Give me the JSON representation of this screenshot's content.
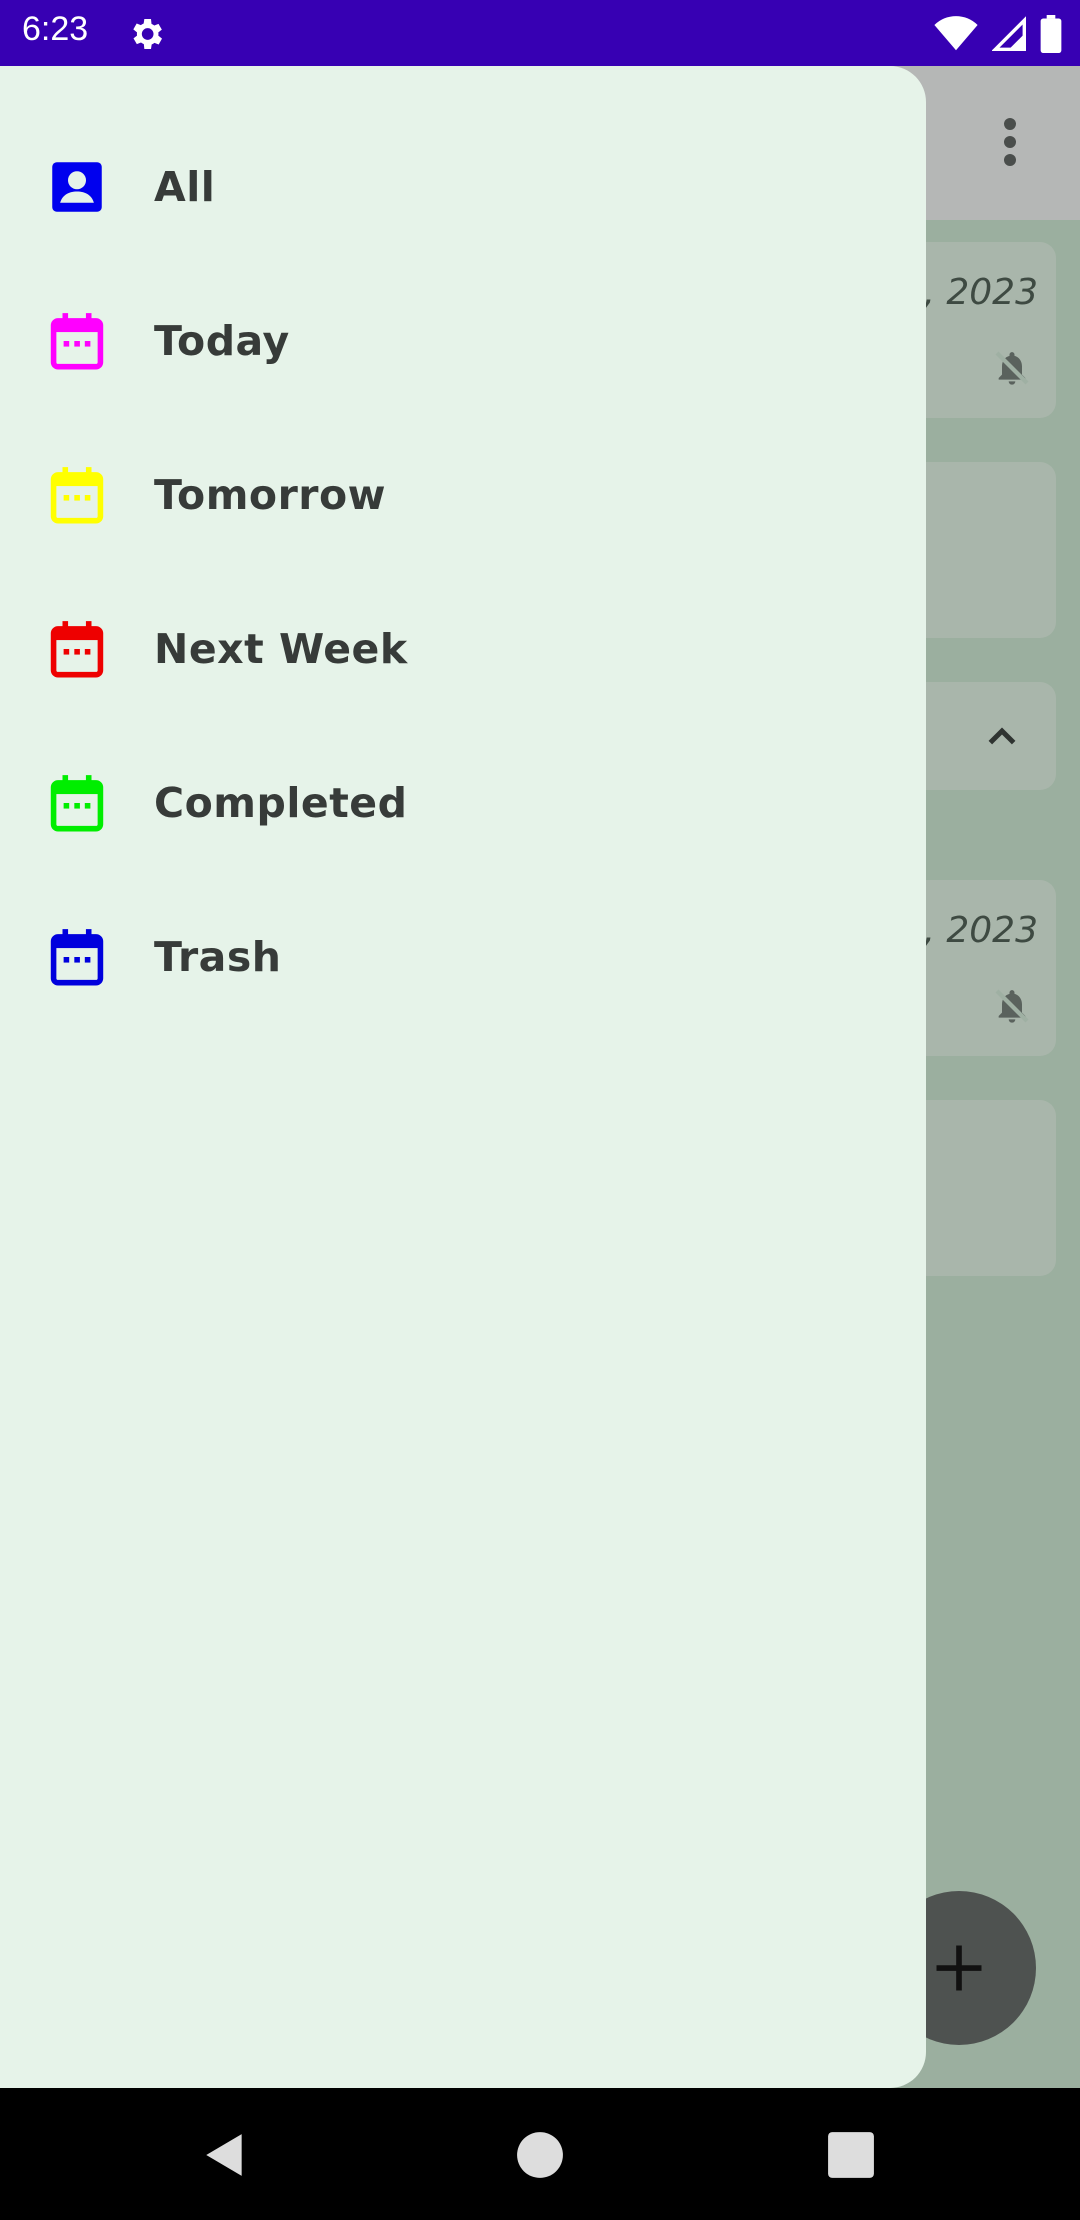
{
  "status_bar": {
    "time": "6:23",
    "icons": [
      "settings-icon",
      "wifi-icon",
      "signal-icon",
      "battery-icon"
    ],
    "background": "#3700b3"
  },
  "background_app": {
    "cards": [
      {
        "date": ", 2023",
        "icon": "bell-off-icon"
      },
      {
        "date": "",
        "icon": ""
      },
      {
        "date": ", 2023",
        "icon": "bell-off-icon"
      },
      {
        "date": "",
        "icon": ""
      }
    ],
    "section_toggle_icon": "chevron-up-icon",
    "fab_icon": "plus-icon"
  },
  "drawer": {
    "items": [
      {
        "label": "All",
        "icon": "person-icon",
        "color": "#0000ee"
      },
      {
        "label": "Today",
        "icon": "calendar-icon",
        "color": "#ff00ff"
      },
      {
        "label": "Tomorrow",
        "icon": "calendar-icon",
        "color": "#ffff00"
      },
      {
        "label": "Next Week",
        "icon": "calendar-icon",
        "color": "#ee0000"
      },
      {
        "label": "Completed",
        "icon": "calendar-icon",
        "color": "#00ee00"
      },
      {
        "label": "Trash",
        "icon": "calendar-icon",
        "color": "#0000dd"
      }
    ]
  },
  "nav_bar": {
    "icons": [
      "back-icon",
      "home-icon",
      "recents-icon"
    ]
  }
}
